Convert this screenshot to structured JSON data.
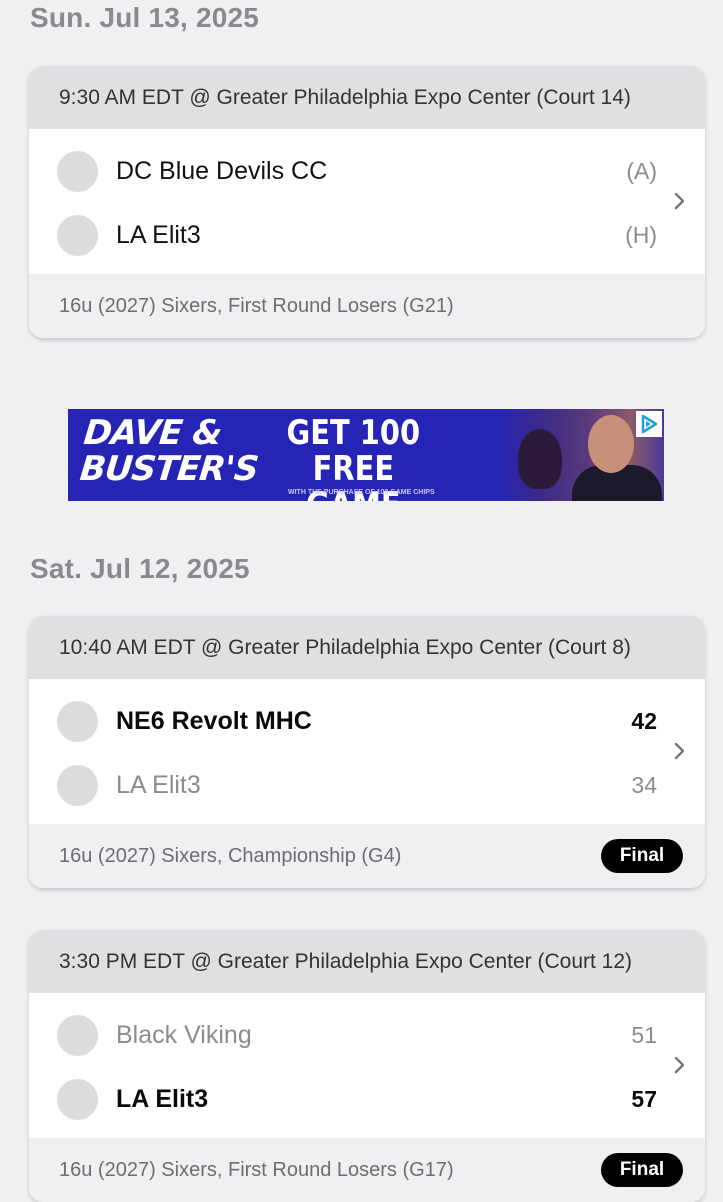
{
  "sections": [
    {
      "date": "Sun. Jul 13, 2025",
      "games": [
        {
          "header": "9:30 AM EDT @ Greater Philadelphia Expo Center (Court 14)",
          "teams": [
            {
              "name": "DC Blue Devils CC",
              "value": "(A)"
            },
            {
              "name": "LA Elit3",
              "value": "(H)"
            }
          ],
          "footer": "16u (2027) Sixers, First Round Losers (G21)"
        }
      ]
    },
    {
      "date": "Sat. Jul 12, 2025",
      "games": [
        {
          "header": "10:40 AM EDT @ Greater Philadelphia Expo Center (Court 8)",
          "teams": [
            {
              "name": "NE6 Revolt MHC",
              "value": "42"
            },
            {
              "name": "LA Elit3",
              "value": "34"
            }
          ],
          "footer": "16u (2027) Sixers, Championship (G4)",
          "status": "Final"
        },
        {
          "header": "3:30 PM EDT @ Greater Philadelphia Expo Center (Court 12)",
          "teams": [
            {
              "name": "Black Viking",
              "value": "51"
            },
            {
              "name": "LA Elit3",
              "value": "57"
            }
          ],
          "footer": "16u (2027) Sixers, First Round Losers (G17)",
          "status": "Final"
        }
      ]
    }
  ],
  "ad": {
    "logo_line1": "DAVE &",
    "logo_line2": "BUSTER'S",
    "headline_line1": "GET 100 FREE",
    "headline_line2": "GAME CHIPS",
    "fine_print": "WITH THE PURCHASE OF 100 GAME CHIPS",
    "background_color": "#2624b4",
    "adchoices_icon": "adchoices-icon"
  },
  "colors": {
    "page_bg": "#f0f0f3",
    "header_bg": "#e0e0e3",
    "badge_bg": "#000000",
    "muted_text": "#8c8c90"
  }
}
